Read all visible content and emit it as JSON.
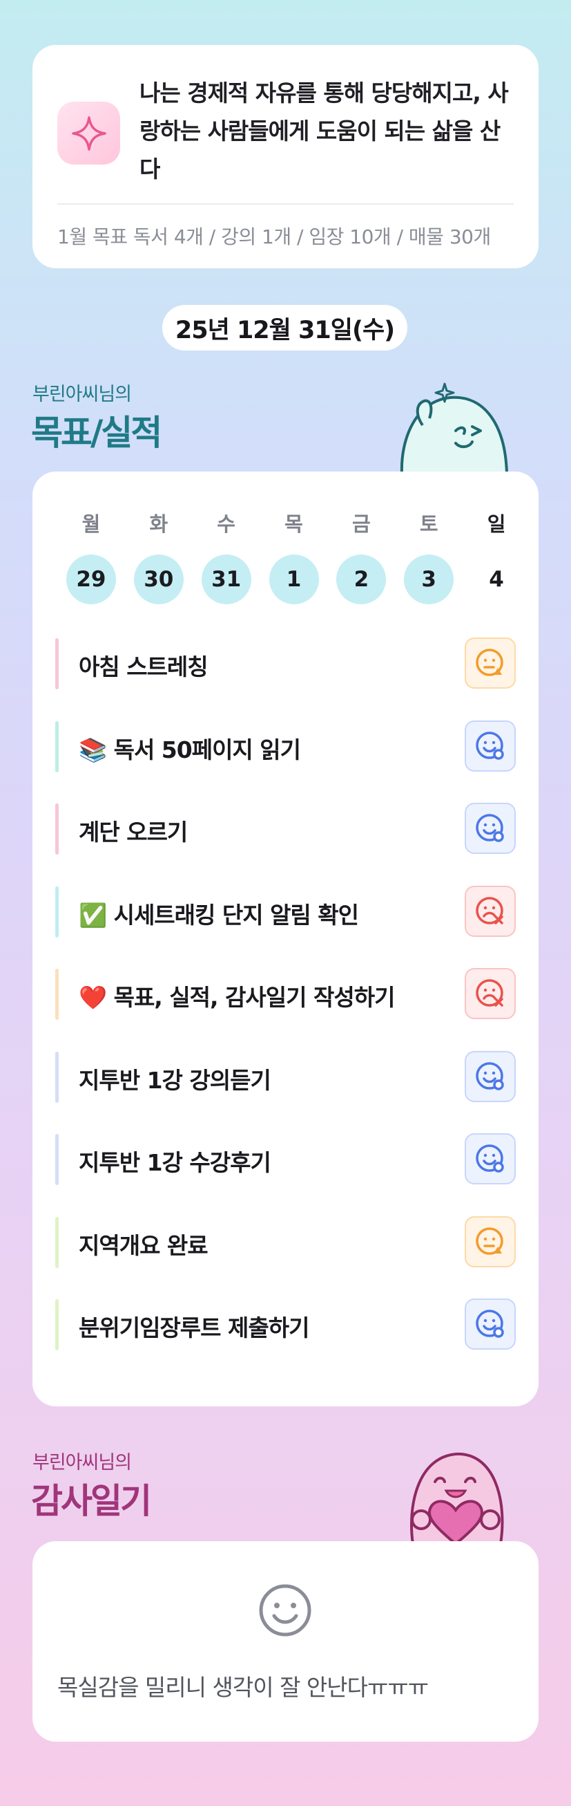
{
  "motto": {
    "text": "나는 경제적 자유를 통해 당당해지고, 사랑하는 사람들에게 도움이 되는 삶을 산다",
    "goal_summary": "1월 목표  독서 4개 / 강의 1개 / 임장 10개 / 매물 30개",
    "icon": "sparkle-icon"
  },
  "date": "25년 12월 31일(수)",
  "goals_section": {
    "subtitle": "부린아씨님의",
    "title": "목표/실적"
  },
  "calendar": {
    "days": [
      {
        "label": "월",
        "num": "29",
        "highlight": true
      },
      {
        "label": "화",
        "num": "30",
        "highlight": true
      },
      {
        "label": "수",
        "num": "31",
        "highlight": true
      },
      {
        "label": "목",
        "num": "1",
        "highlight": true
      },
      {
        "label": "금",
        "num": "2",
        "highlight": true
      },
      {
        "label": "토",
        "num": "3",
        "highlight": true
      },
      {
        "label": "일",
        "num": "4",
        "highlight": false
      }
    ]
  },
  "goals": [
    {
      "label": "아침 스트레칭",
      "status": "neutral",
      "bar_color": "#f7c6d8"
    },
    {
      "label": "📚 독서 50페이지 읽기",
      "status": "good",
      "bar_color": "#bdeee4"
    },
    {
      "label": "계단 오르기",
      "status": "good",
      "bar_color": "#f7c6d8"
    },
    {
      "label": "✅ 시세트래킹 단지 알림 확인",
      "status": "bad",
      "bar_color": "#bfeef3"
    },
    {
      "label": "❤️ 목표, 실적, 감사일기 작성하기",
      "status": "bad",
      "bar_color": "#fbe0bd"
    },
    {
      "label": "지투반 1강 강의듣기",
      "status": "good",
      "bar_color": "#d5def8"
    },
    {
      "label": "지투반 1강 수강후기",
      "status": "good",
      "bar_color": "#d5def8"
    },
    {
      "label": "지역개요 완료",
      "status": "neutral",
      "bar_color": "#def3c4"
    },
    {
      "label": "분위기임장루트 제출하기",
      "status": "good",
      "bar_color": "#def3c4"
    }
  ],
  "status_colors": {
    "neutral": "#f39b2c",
    "good": "#4b78e6",
    "bad": "#e8534b"
  },
  "diary_section": {
    "subtitle": "부린아씨님의",
    "title": "감사일기"
  },
  "diary": {
    "text": "목실감을 밀리니 생각이 잘 안난다ㅠㅠㅠ",
    "icon": "smile-face-icon"
  },
  "colors": {
    "goals_title": "#1f7a86",
    "diary_title": "#a0357a"
  }
}
